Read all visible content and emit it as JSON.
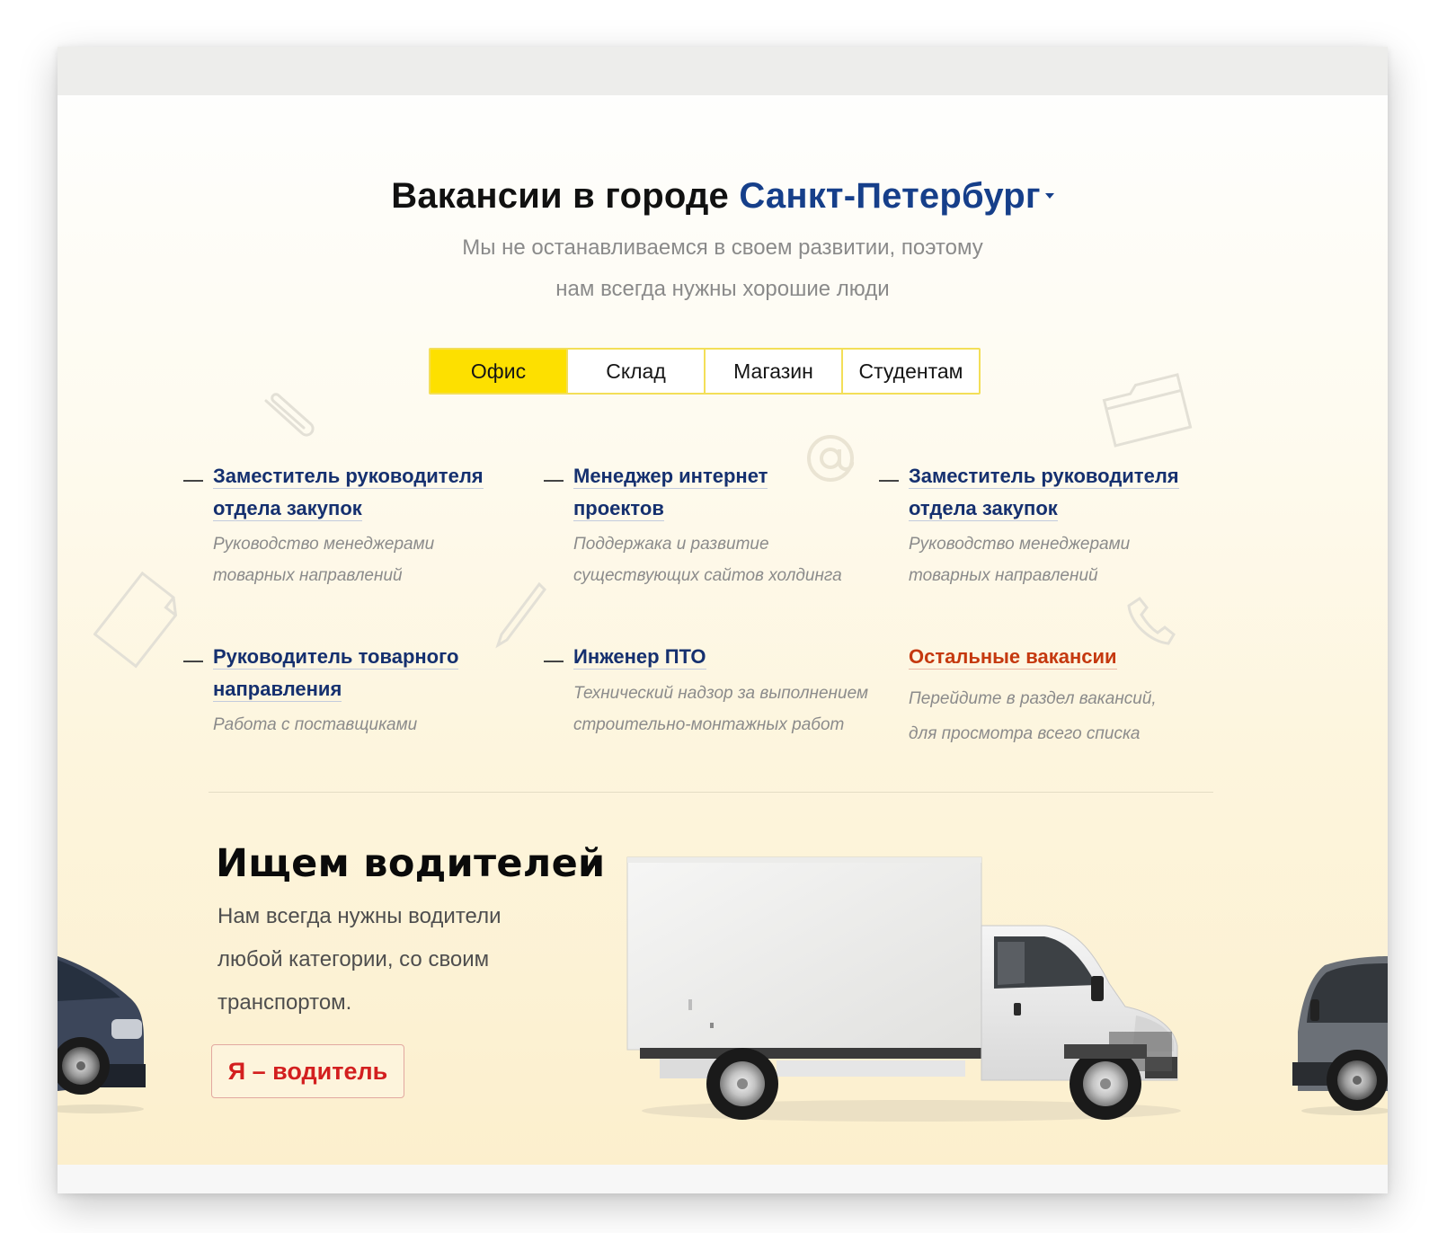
{
  "header": {
    "title_prefix": "Вакансии в городе",
    "city": "Санкт-Петербург",
    "subtitle_lines": [
      "Мы не останавливаемся в своем развитии, поэтому",
      "нам всегда нужны хорошие люди"
    ]
  },
  "tabs": [
    {
      "label": "Офис",
      "active": true
    },
    {
      "label": "Склад",
      "active": false
    },
    {
      "label": "Магазин",
      "active": false
    },
    {
      "label": "Студентам",
      "active": false
    }
  ],
  "jobs": [
    {
      "title_lines": [
        "Заместитель руководителя",
        "отдела закупок"
      ],
      "desc_lines": [
        "Руководство менеджерами",
        "товарных направлений"
      ]
    },
    {
      "title_lines": [
        "Менеджер интернет",
        "проектов"
      ],
      "desc_lines": [
        "Поддержака и развитие",
        "существующих сайтов холдинга"
      ]
    },
    {
      "title_lines": [
        "Заместитель руководителя",
        "отдела закупок"
      ],
      "desc_lines": [
        "Руководство менеджерами",
        "товарных направлений"
      ]
    },
    {
      "title_lines": [
        "Руководитель товарного",
        "направления"
      ],
      "desc_lines": [
        "Работа с поставщиками"
      ]
    },
    {
      "title_lines": [
        "Инженер ПТО"
      ],
      "desc_lines": [
        "Технический надзор за выполнением",
        "строительно-монтажных работ"
      ]
    },
    {
      "title_lines": [
        "Остальные вакансии"
      ],
      "desc_lines": [
        "Перейдите в раздел вакансий,",
        "для просмотра всего списка"
      ]
    }
  ],
  "drivers": {
    "title": "Ищем водителей",
    "text_lines": [
      "Нам всегда нужны водители",
      "любой категории, со своим",
      "транспортом."
    ],
    "button": "Я – водитель"
  },
  "colors": {
    "accent_yellow": "#fde000",
    "link_blue": "#15306f",
    "city_blue": "#163f8a",
    "link_red": "#c5390f",
    "button_red": "#d31f1f"
  },
  "decor_icons": [
    "paperclip-icon",
    "at-sign-icon",
    "folder-icon",
    "sheet-icon",
    "pen-icon",
    "phone-icon"
  ]
}
